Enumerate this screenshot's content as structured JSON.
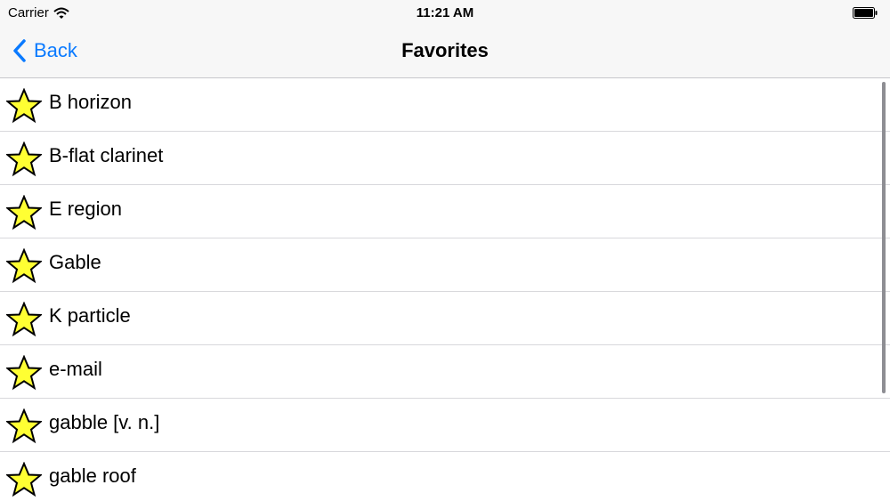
{
  "status_bar": {
    "carrier": "Carrier",
    "time": "11:21 AM",
    "icons": [
      "wifi-icon",
      "battery-icon"
    ]
  },
  "nav": {
    "back_label": "Back",
    "title": "Favorites",
    "accent_color": "#0a7aff"
  },
  "favorites": [
    {
      "label": "B horizon",
      "icon": "star-icon"
    },
    {
      "label": "B-flat clarinet",
      "icon": "star-icon"
    },
    {
      "label": "E region",
      "icon": "star-icon"
    },
    {
      "label": "Gable",
      "icon": "star-icon"
    },
    {
      "label": "K particle",
      "icon": "star-icon"
    },
    {
      "label": "e-mail",
      "icon": "star-icon"
    },
    {
      "label": "gabble [v. n.]",
      "icon": "star-icon"
    },
    {
      "label": "gable roof",
      "icon": "star-icon"
    }
  ],
  "colors": {
    "star_fill": "#ffff33",
    "star_stroke": "#000000",
    "bar_background": "#f7f7f7",
    "separator": "#d8d8dc"
  }
}
